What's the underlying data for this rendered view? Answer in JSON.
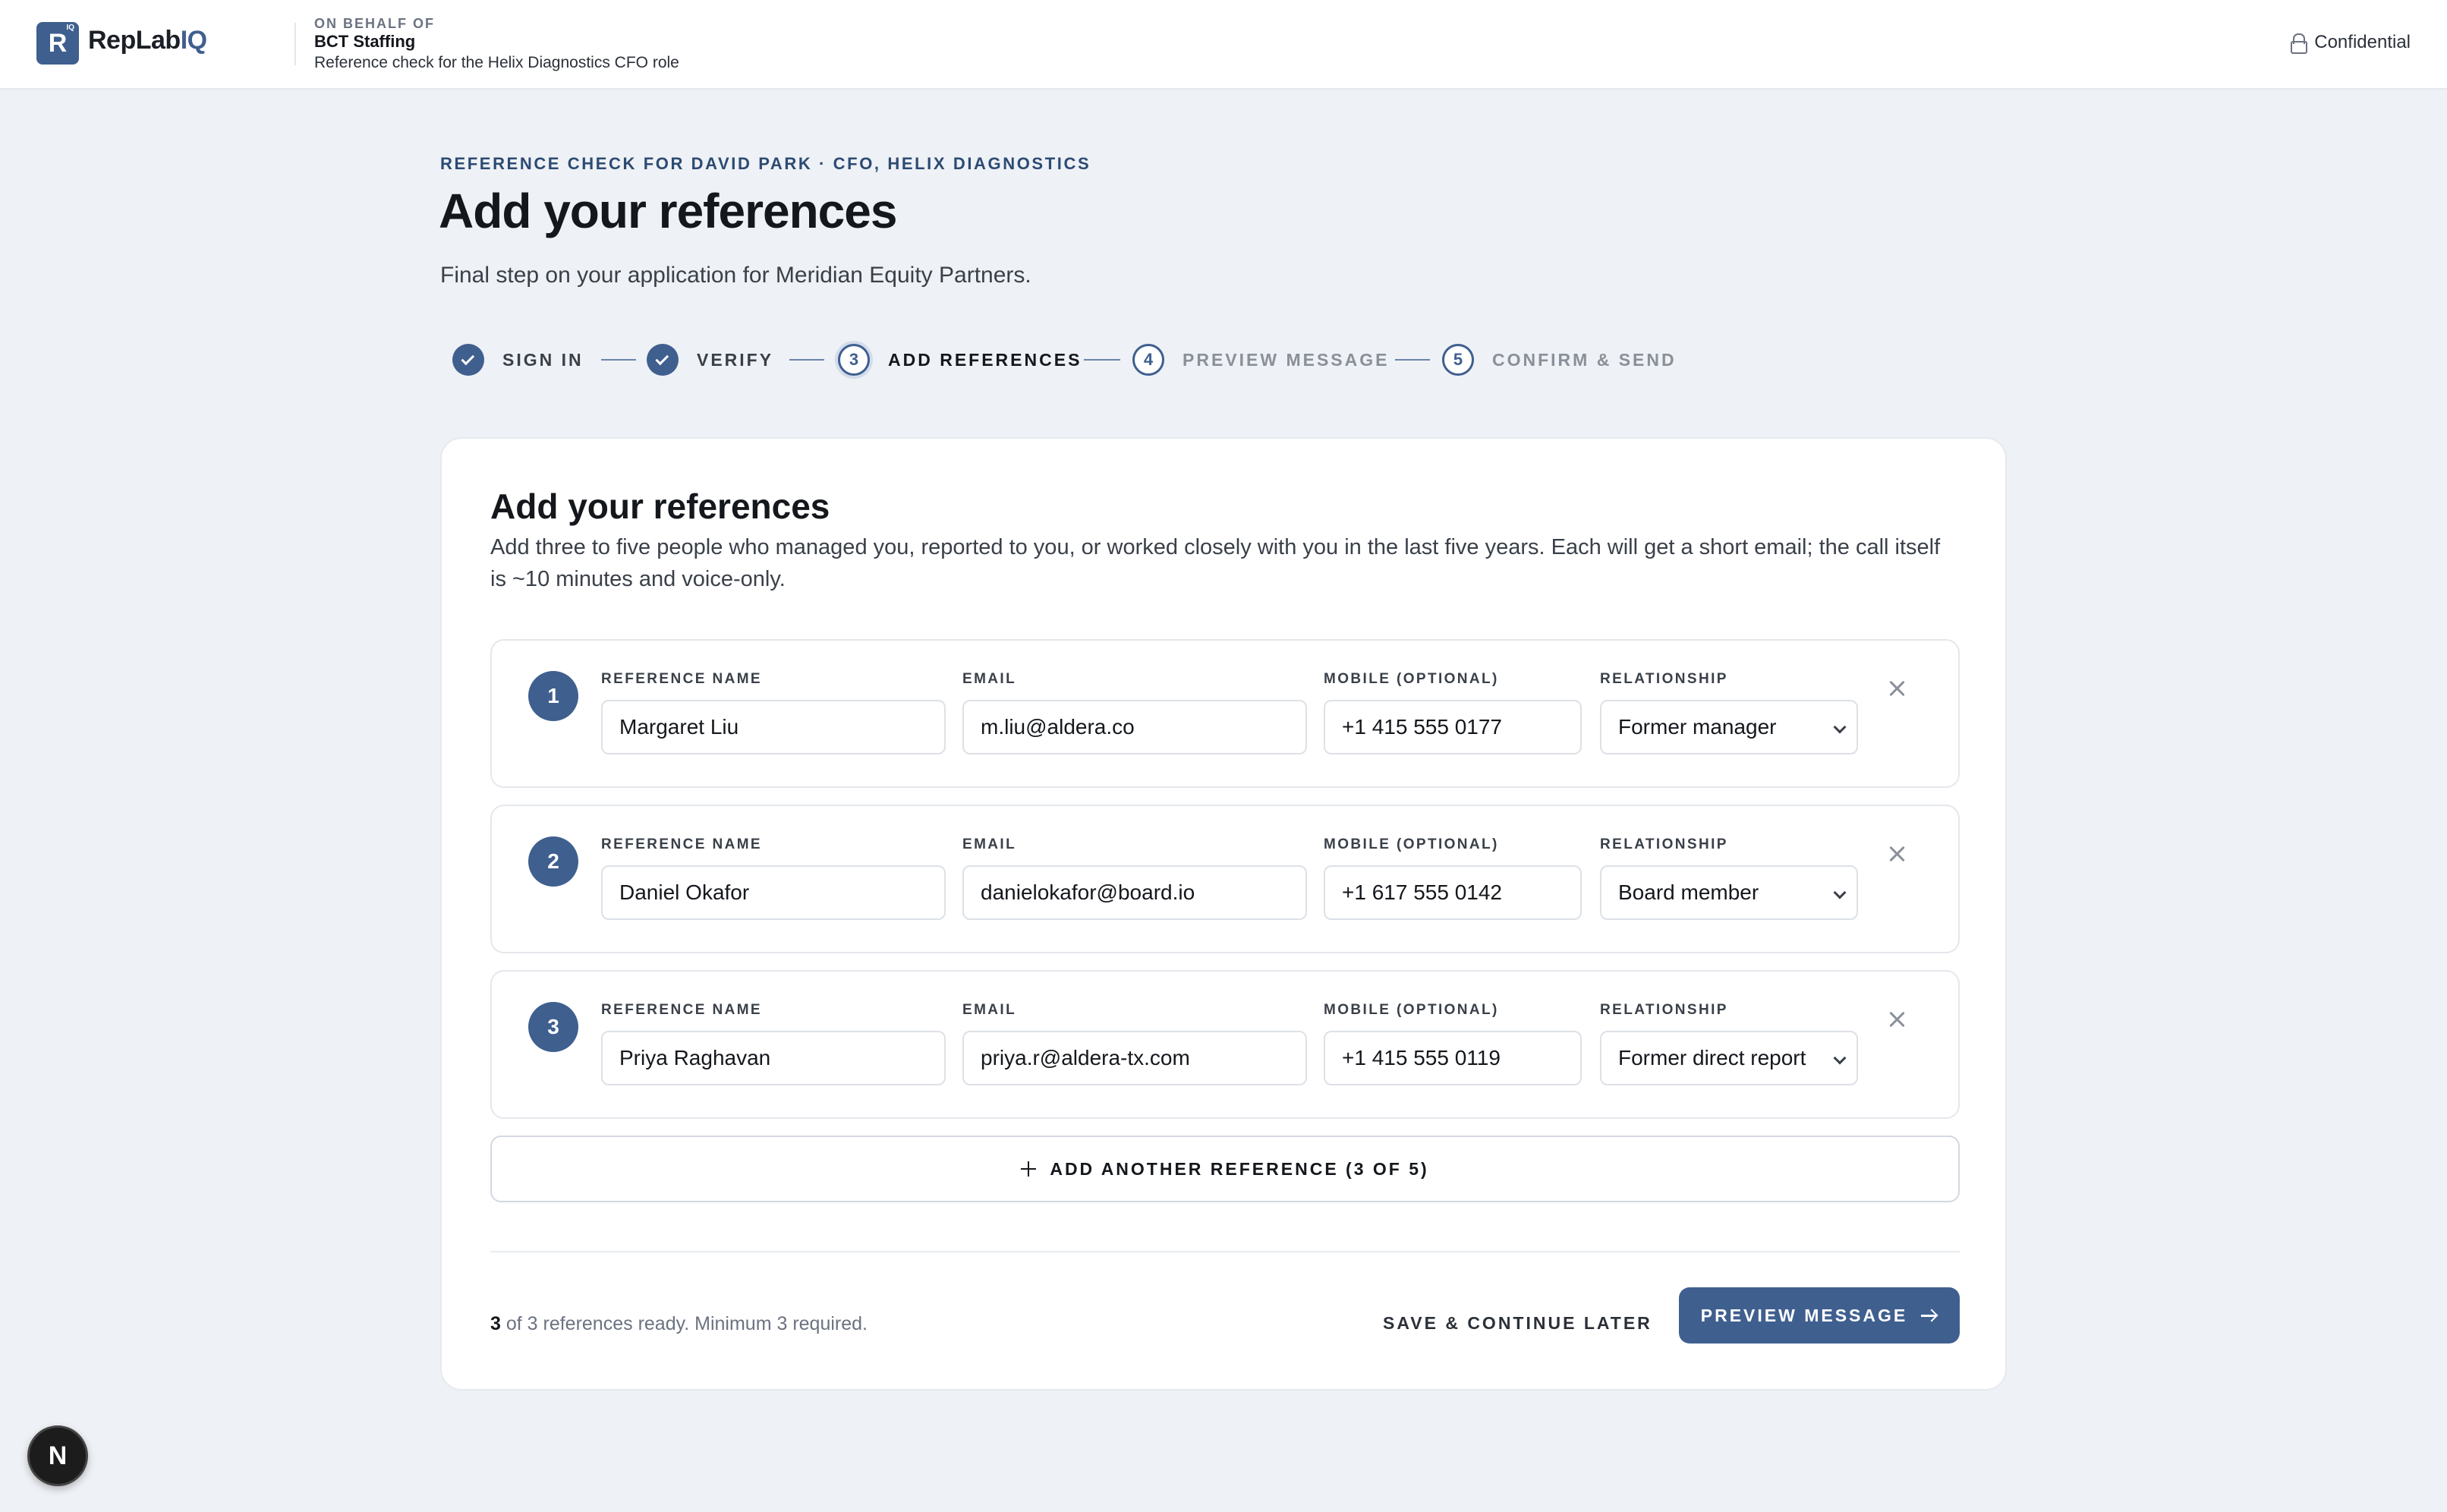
{
  "header": {
    "logo_mark": "R",
    "logo_mark_sup": "IQ",
    "logo_text_main": "RepLab",
    "logo_text_accent": "IQ",
    "behalf_label": "ON BEHALF OF",
    "behalf_company": "BCT Staffing",
    "behalf_desc": "Reference check for the Helix Diagnostics CFO role",
    "confidential_label": "Confidential"
  },
  "intro": {
    "eyebrow": "REFERENCE CHECK FOR DAVID PARK · CFO, HELIX DIAGNOSTICS",
    "title": "Add your references",
    "subtitle": "Final step on your application for Meridian Equity Partners."
  },
  "stepper": {
    "steps": [
      {
        "number": "1",
        "label": "SIGN IN",
        "state": "done"
      },
      {
        "number": "2",
        "label": "VERIFY",
        "state": "done"
      },
      {
        "number": "3",
        "label": "ADD REFERENCES",
        "state": "current"
      },
      {
        "number": "4",
        "label": "PREVIEW MESSAGE",
        "state": "future"
      },
      {
        "number": "5",
        "label": "CONFIRM & SEND",
        "state": "future"
      }
    ]
  },
  "card": {
    "title": "Add your references",
    "description": "Add three to five people who managed you, reported to you, or worked closely with you in the last five years. Each will get a short email; the call itself is ~10 minutes and voice-only.",
    "field_labels": {
      "name": "REFERENCE NAME",
      "email": "EMAIL",
      "mobile": "MOBILE (OPTIONAL)",
      "relationship": "RELATIONSHIP"
    },
    "references": [
      {
        "number": "1",
        "name": "Margaret Liu",
        "email": "m.liu@aldera.co",
        "mobile": "+1 415 555 0177",
        "relationship": "Former manager"
      },
      {
        "number": "2",
        "name": "Daniel Okafor",
        "email": "danielokafor@board.io",
        "mobile": "+1 617 555 0142",
        "relationship": "Board member"
      },
      {
        "number": "3",
        "name": "Priya Raghavan",
        "email": "priya.r@aldera-tx.com",
        "mobile": "+1 415 555 0119",
        "relationship": "Former direct report"
      }
    ],
    "add_reference_label": "ADD ANOTHER REFERENCE (3 OF 5)",
    "footer": {
      "ready_count": "3",
      "ready_text": "of 3 references ready. Minimum 3 required.",
      "save_later_label": "SAVE & CONTINUE LATER",
      "preview_label": "PREVIEW MESSAGE"
    }
  },
  "dev_badge": "N",
  "colors": {
    "accent": "#3f5f8f",
    "background": "#eef1f5",
    "card": "#ffffff"
  }
}
